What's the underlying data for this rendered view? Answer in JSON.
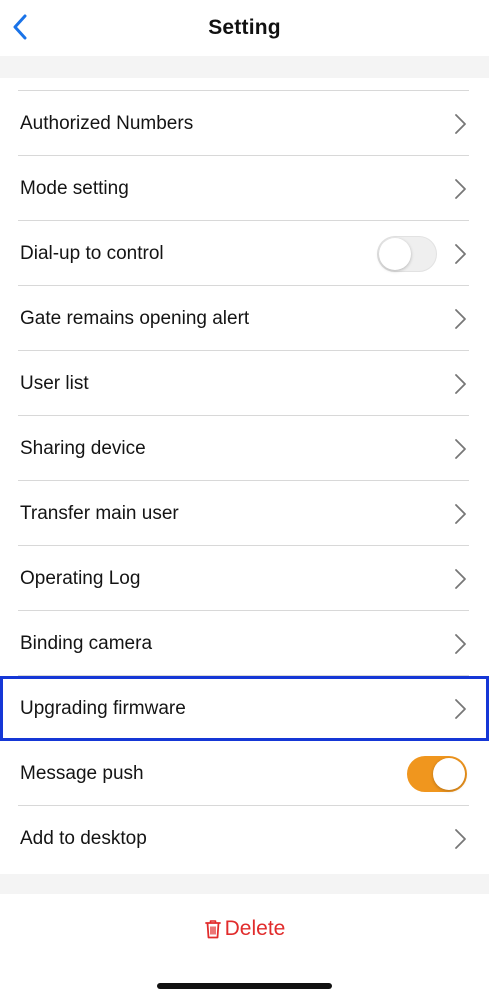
{
  "header": {
    "title": "Setting",
    "back_icon": "chevron-left-icon",
    "accent_color": "#1a73e8"
  },
  "settings": {
    "items": [
      {
        "label": "Authorized Numbers",
        "control": "chevron"
      },
      {
        "label": "Mode setting",
        "control": "chevron"
      },
      {
        "label": "Dial-up to control",
        "control": "toggle+chevron",
        "toggle_on": false
      },
      {
        "label": "Gate remains opening alert",
        "control": "chevron"
      },
      {
        "label": "User list",
        "control": "chevron"
      },
      {
        "label": "Sharing device",
        "control": "chevron"
      },
      {
        "label": "Transfer main user",
        "control": "chevron"
      },
      {
        "label": "Operating Log",
        "control": "chevron"
      },
      {
        "label": "Binding camera",
        "control": "chevron"
      },
      {
        "label": "Upgrading firmware",
        "control": "chevron",
        "highlighted": true
      },
      {
        "label": "Message push",
        "control": "toggle",
        "toggle_on": true
      },
      {
        "label": "Add to desktop",
        "control": "chevron"
      }
    ],
    "toggle_on_color": "#f0961e",
    "highlight_color": "#1537d6"
  },
  "footer": {
    "delete_label": "Delete",
    "delete_color": "#e12c2c",
    "delete_icon": "trash-icon"
  }
}
